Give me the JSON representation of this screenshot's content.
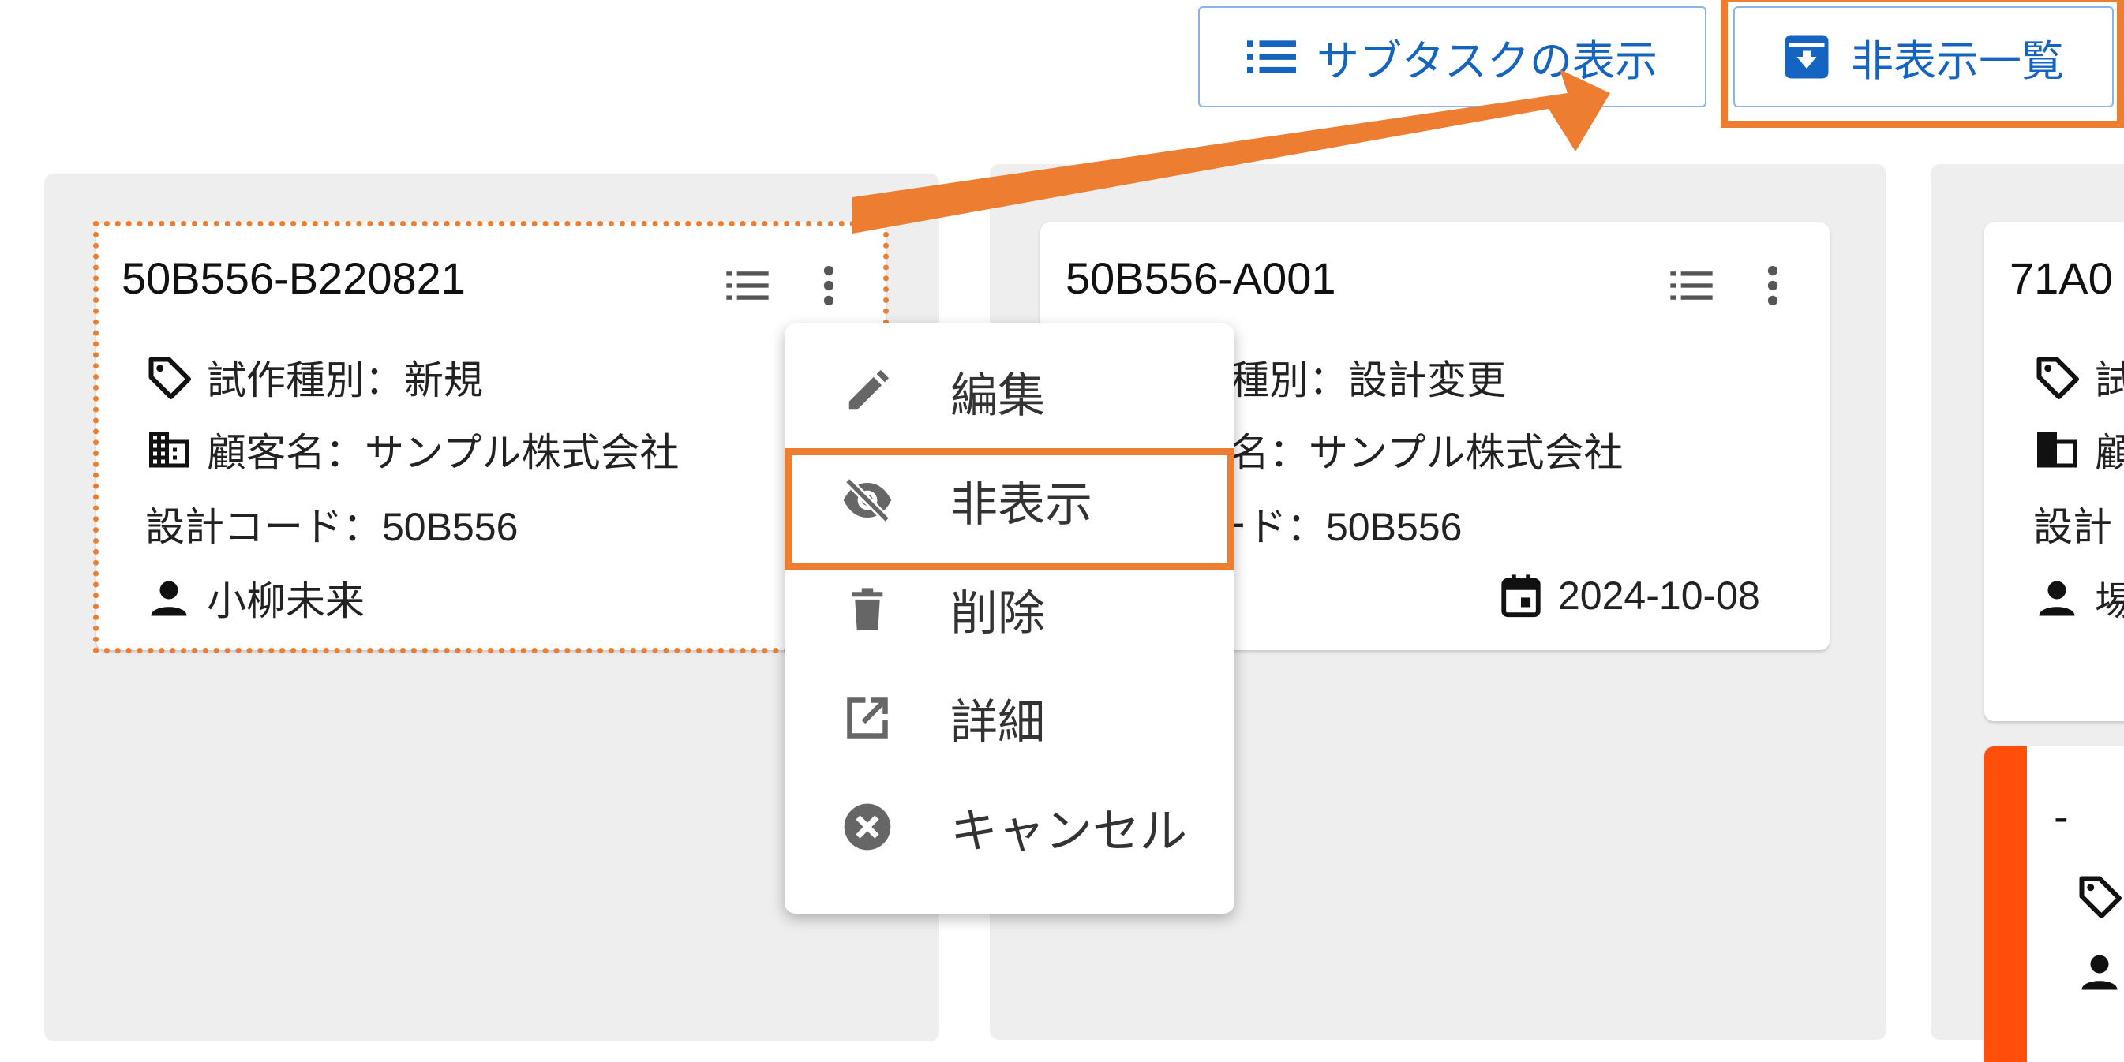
{
  "toolbar": {
    "subtask_label": "サブタスクの表示",
    "hidden_list_label": "非表示一覧"
  },
  "cards": [
    {
      "title": "50B556-B220821",
      "type_row": "試作種別：新規",
      "customer_row": "顧客名：サンプル株式会社",
      "code_row": "設計コード：50B556",
      "person_row": "小柳未来"
    },
    {
      "title": "50B556-A001",
      "type_row": "試作種別：設計変更",
      "customer_row": "顧客名：サンプル株式会社",
      "code_row": "設計コード：50B556",
      "date": "2024-10-08"
    },
    {
      "title": "71A0",
      "type_row": "試",
      "customer_row": "顧",
      "code_row": "設計",
      "person_row": "埸"
    },
    {
      "title": "-"
    }
  ],
  "menu": {
    "items": [
      {
        "label": "編集",
        "icon": "pencil-icon"
      },
      {
        "label": "非表示",
        "icon": "eye-off-icon"
      },
      {
        "label": "削除",
        "icon": "trash-icon"
      },
      {
        "label": "詳細",
        "icon": "open-in-new-icon"
      },
      {
        "label": "キャンセル",
        "icon": "cancel-circle-icon"
      }
    ]
  },
  "colors": {
    "accent_blue": "#1565c0",
    "annotation_orange": "#ed7d31",
    "status_orange": "#ff4f0a",
    "column_bg": "#eeeeee"
  }
}
